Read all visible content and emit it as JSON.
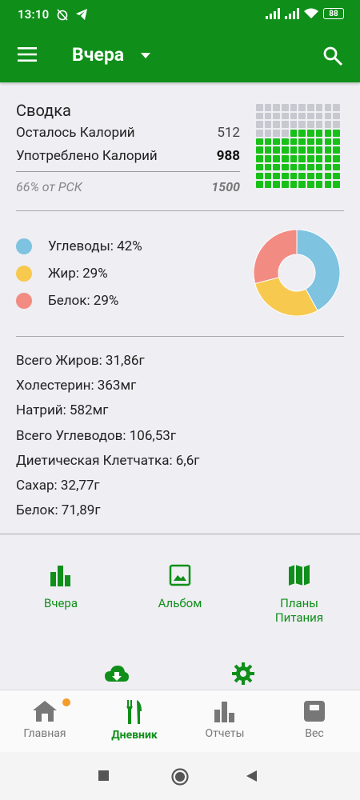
{
  "status": {
    "time": "13:10",
    "battery": "88"
  },
  "appbar": {
    "title": "Вчера"
  },
  "summary": {
    "title": "Сводка",
    "remaining_label": "Осталось Калорий",
    "remaining_value": "512",
    "consumed_label": "Употреблено Калорий",
    "consumed_value": "988",
    "percent_label": "66% от РСК",
    "rsk_value": "1500",
    "grid_filled_fraction": 0.66
  },
  "macros": [
    {
      "label": "Углеводы: 42%",
      "color": "#7ec3e0"
    },
    {
      "label": "Жир: 29%",
      "color": "#f7c94f"
    },
    {
      "label": "Белок: 29%",
      "color": "#f28b82"
    }
  ],
  "chart_data": {
    "type": "pie",
    "categories": [
      "Углеводы",
      "Жир",
      "Белок"
    ],
    "values": [
      42,
      29,
      29
    ],
    "colors": [
      "#7ec3e0",
      "#f7c94f",
      "#f28b82"
    ]
  },
  "nutrients": [
    "Всего Жиров: 31,86г",
    "Холестерин: 363мг",
    "Натрий: 582мг",
    "Всего Углеводов: 106,53г",
    "Диетическая Клетчатка: 6,6г",
    "Сахар: 32,77г",
    "Белок: 71,89г"
  ],
  "actions": {
    "yesterday": "Вчера",
    "album": "Альбом",
    "plans_line1": "Планы",
    "plans_line2": "Питания"
  },
  "tabs": {
    "home": "Главная",
    "diary": "Дневник",
    "reports": "Отчеты",
    "weight": "Вес"
  },
  "colors": {
    "primary": "#0f8f19",
    "grid_filled": "#17c017",
    "grid_empty": "#c8c9d0",
    "badge": "#f39c2a"
  }
}
